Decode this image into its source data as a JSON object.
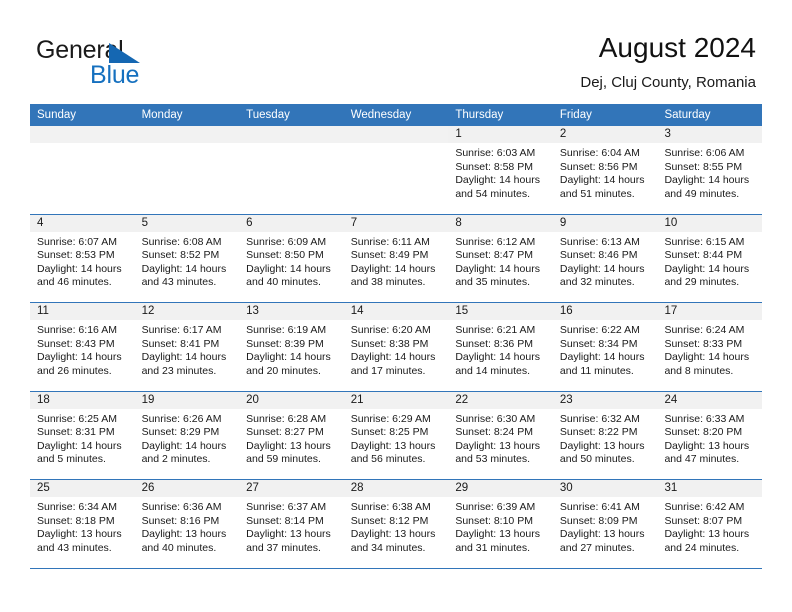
{
  "brand": {
    "word_one": "General",
    "word_two": "Blue",
    "triangle_color": "#1567b2",
    "blue_color": "#1570bf"
  },
  "header": {
    "title": "August 2024",
    "subtitle": "Dej, Cluj County, Romania"
  },
  "theme": {
    "header_bar_color": "#3275b9",
    "daynum_band_color": "#f1f1f1",
    "row_separator_color": "#3275b9"
  },
  "weekdays": [
    "Sunday",
    "Monday",
    "Tuesday",
    "Wednesday",
    "Thursday",
    "Friday",
    "Saturday"
  ],
  "labels": {
    "sunrise": "Sunrise:",
    "sunset": "Sunset:",
    "daylight": "Daylight:"
  },
  "weeks": [
    [
      {
        "day": "",
        "empty": true
      },
      {
        "day": "",
        "empty": true
      },
      {
        "day": "",
        "empty": true
      },
      {
        "day": "",
        "empty": true
      },
      {
        "day": "1",
        "sunrise": "Sunrise: 6:03 AM",
        "sunset": "Sunset: 8:58 PM",
        "daylight_line1": "Daylight: 14 hours",
        "daylight_line2": "and 54 minutes."
      },
      {
        "day": "2",
        "sunrise": "Sunrise: 6:04 AM",
        "sunset": "Sunset: 8:56 PM",
        "daylight_line1": "Daylight: 14 hours",
        "daylight_line2": "and 51 minutes."
      },
      {
        "day": "3",
        "sunrise": "Sunrise: 6:06 AM",
        "sunset": "Sunset: 8:55 PM",
        "daylight_line1": "Daylight: 14 hours",
        "daylight_line2": "and 49 minutes."
      }
    ],
    [
      {
        "day": "4",
        "sunrise": "Sunrise: 6:07 AM",
        "sunset": "Sunset: 8:53 PM",
        "daylight_line1": "Daylight: 14 hours",
        "daylight_line2": "and 46 minutes."
      },
      {
        "day": "5",
        "sunrise": "Sunrise: 6:08 AM",
        "sunset": "Sunset: 8:52 PM",
        "daylight_line1": "Daylight: 14 hours",
        "daylight_line2": "and 43 minutes."
      },
      {
        "day": "6",
        "sunrise": "Sunrise: 6:09 AM",
        "sunset": "Sunset: 8:50 PM",
        "daylight_line1": "Daylight: 14 hours",
        "daylight_line2": "and 40 minutes."
      },
      {
        "day": "7",
        "sunrise": "Sunrise: 6:11 AM",
        "sunset": "Sunset: 8:49 PM",
        "daylight_line1": "Daylight: 14 hours",
        "daylight_line2": "and 38 minutes."
      },
      {
        "day": "8",
        "sunrise": "Sunrise: 6:12 AM",
        "sunset": "Sunset: 8:47 PM",
        "daylight_line1": "Daylight: 14 hours",
        "daylight_line2": "and 35 minutes."
      },
      {
        "day": "9",
        "sunrise": "Sunrise: 6:13 AM",
        "sunset": "Sunset: 8:46 PM",
        "daylight_line1": "Daylight: 14 hours",
        "daylight_line2": "and 32 minutes."
      },
      {
        "day": "10",
        "sunrise": "Sunrise: 6:15 AM",
        "sunset": "Sunset: 8:44 PM",
        "daylight_line1": "Daylight: 14 hours",
        "daylight_line2": "and 29 minutes."
      }
    ],
    [
      {
        "day": "11",
        "sunrise": "Sunrise: 6:16 AM",
        "sunset": "Sunset: 8:43 PM",
        "daylight_line1": "Daylight: 14 hours",
        "daylight_line2": "and 26 minutes."
      },
      {
        "day": "12",
        "sunrise": "Sunrise: 6:17 AM",
        "sunset": "Sunset: 8:41 PM",
        "daylight_line1": "Daylight: 14 hours",
        "daylight_line2": "and 23 minutes."
      },
      {
        "day": "13",
        "sunrise": "Sunrise: 6:19 AM",
        "sunset": "Sunset: 8:39 PM",
        "daylight_line1": "Daylight: 14 hours",
        "daylight_line2": "and 20 minutes."
      },
      {
        "day": "14",
        "sunrise": "Sunrise: 6:20 AM",
        "sunset": "Sunset: 8:38 PM",
        "daylight_line1": "Daylight: 14 hours",
        "daylight_line2": "and 17 minutes."
      },
      {
        "day": "15",
        "sunrise": "Sunrise: 6:21 AM",
        "sunset": "Sunset: 8:36 PM",
        "daylight_line1": "Daylight: 14 hours",
        "daylight_line2": "and 14 minutes."
      },
      {
        "day": "16",
        "sunrise": "Sunrise: 6:22 AM",
        "sunset": "Sunset: 8:34 PM",
        "daylight_line1": "Daylight: 14 hours",
        "daylight_line2": "and 11 minutes."
      },
      {
        "day": "17",
        "sunrise": "Sunrise: 6:24 AM",
        "sunset": "Sunset: 8:33 PM",
        "daylight_line1": "Daylight: 14 hours",
        "daylight_line2": "and 8 minutes."
      }
    ],
    [
      {
        "day": "18",
        "sunrise": "Sunrise: 6:25 AM",
        "sunset": "Sunset: 8:31 PM",
        "daylight_line1": "Daylight: 14 hours",
        "daylight_line2": "and 5 minutes."
      },
      {
        "day": "19",
        "sunrise": "Sunrise: 6:26 AM",
        "sunset": "Sunset: 8:29 PM",
        "daylight_line1": "Daylight: 14 hours",
        "daylight_line2": "and 2 minutes."
      },
      {
        "day": "20",
        "sunrise": "Sunrise: 6:28 AM",
        "sunset": "Sunset: 8:27 PM",
        "daylight_line1": "Daylight: 13 hours",
        "daylight_line2": "and 59 minutes."
      },
      {
        "day": "21",
        "sunrise": "Sunrise: 6:29 AM",
        "sunset": "Sunset: 8:25 PM",
        "daylight_line1": "Daylight: 13 hours",
        "daylight_line2": "and 56 minutes."
      },
      {
        "day": "22",
        "sunrise": "Sunrise: 6:30 AM",
        "sunset": "Sunset: 8:24 PM",
        "daylight_line1": "Daylight: 13 hours",
        "daylight_line2": "and 53 minutes."
      },
      {
        "day": "23",
        "sunrise": "Sunrise: 6:32 AM",
        "sunset": "Sunset: 8:22 PM",
        "daylight_line1": "Daylight: 13 hours",
        "daylight_line2": "and 50 minutes."
      },
      {
        "day": "24",
        "sunrise": "Sunrise: 6:33 AM",
        "sunset": "Sunset: 8:20 PM",
        "daylight_line1": "Daylight: 13 hours",
        "daylight_line2": "and 47 minutes."
      }
    ],
    [
      {
        "day": "25",
        "sunrise": "Sunrise: 6:34 AM",
        "sunset": "Sunset: 8:18 PM",
        "daylight_line1": "Daylight: 13 hours",
        "daylight_line2": "and 43 minutes."
      },
      {
        "day": "26",
        "sunrise": "Sunrise: 6:36 AM",
        "sunset": "Sunset: 8:16 PM",
        "daylight_line1": "Daylight: 13 hours",
        "daylight_line2": "and 40 minutes."
      },
      {
        "day": "27",
        "sunrise": "Sunrise: 6:37 AM",
        "sunset": "Sunset: 8:14 PM",
        "daylight_line1": "Daylight: 13 hours",
        "daylight_line2": "and 37 minutes."
      },
      {
        "day": "28",
        "sunrise": "Sunrise: 6:38 AM",
        "sunset": "Sunset: 8:12 PM",
        "daylight_line1": "Daylight: 13 hours",
        "daylight_line2": "and 34 minutes."
      },
      {
        "day": "29",
        "sunrise": "Sunrise: 6:39 AM",
        "sunset": "Sunset: 8:10 PM",
        "daylight_line1": "Daylight: 13 hours",
        "daylight_line2": "and 31 minutes."
      },
      {
        "day": "30",
        "sunrise": "Sunrise: 6:41 AM",
        "sunset": "Sunset: 8:09 PM",
        "daylight_line1": "Daylight: 13 hours",
        "daylight_line2": "and 27 minutes."
      },
      {
        "day": "31",
        "sunrise": "Sunrise: 6:42 AM",
        "sunset": "Sunset: 8:07 PM",
        "daylight_line1": "Daylight: 13 hours",
        "daylight_line2": "and 24 minutes."
      }
    ]
  ]
}
